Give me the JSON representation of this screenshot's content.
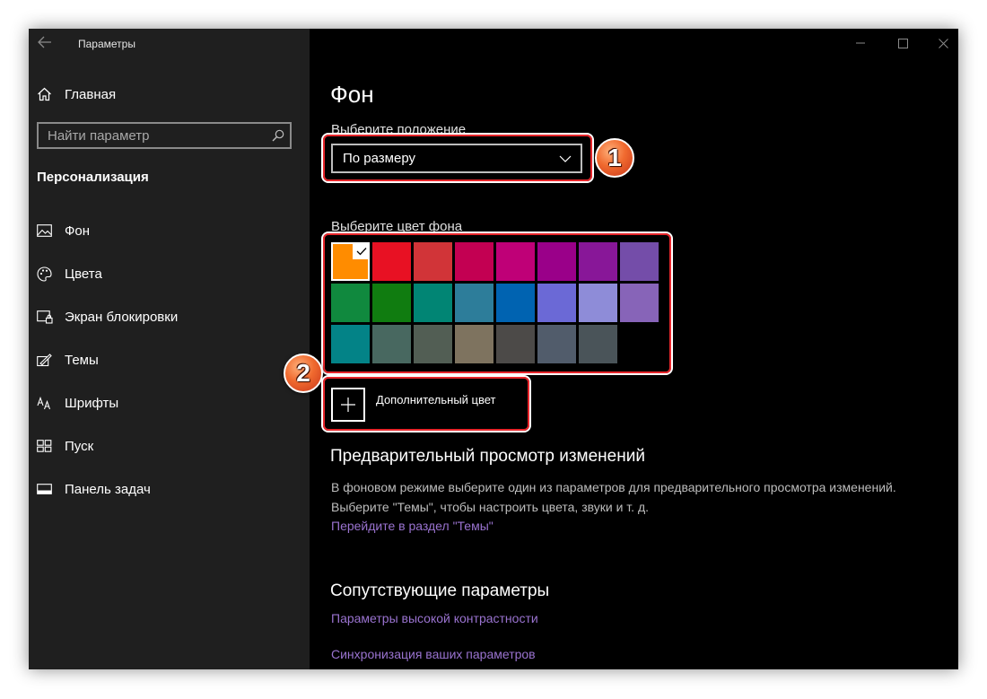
{
  "window": {
    "title": "Параметры"
  },
  "sidebar": {
    "home_label": "Главная",
    "search_placeholder": "Найти параметр",
    "section_title": "Персонализация",
    "items": [
      {
        "label": "Фон",
        "icon": "picture-icon"
      },
      {
        "label": "Цвета",
        "icon": "palette-icon"
      },
      {
        "label": "Экран блокировки",
        "icon": "lock-screen-icon"
      },
      {
        "label": "Темы",
        "icon": "themes-icon"
      },
      {
        "label": "Шрифты",
        "icon": "fonts-icon"
      },
      {
        "label": "Пуск",
        "icon": "start-icon"
      },
      {
        "label": "Панель задач",
        "icon": "taskbar-icon"
      }
    ]
  },
  "main": {
    "title": "Фон",
    "position_label": "Выберите положение",
    "position_value": "По размеру",
    "color_label": "Выберите цвет фона",
    "colors": [
      "#ff8c00",
      "#e81123",
      "#d13438",
      "#c30052",
      "#bf0077",
      "#9a0089",
      "#881798",
      "#744da9",
      "#10893e",
      "#107c10",
      "#018574",
      "#2d7d9a",
      "#0063b1",
      "#6b69d6",
      "#8e8cd8",
      "#8764b8",
      "#038387",
      "#486860",
      "#525e54",
      "#7e735f",
      "#4c4a48",
      "#515c6b",
      "#4a5459",
      "#000000"
    ],
    "selected_color_index": 0,
    "custom_color_label": "Дополнительный цвет",
    "preview_heading": "Предварительный просмотр изменений",
    "preview_desc_line1": "В фоновом режиме выберите один из параметров для предварительного просмотра изменений.",
    "preview_desc_line2": "Выберите \"Темы\", чтобы настроить цвета, звуки и т. д.",
    "themes_link": "Перейдите в раздел \"Темы\"",
    "related_heading": "Сопутствующие параметры",
    "related_links": [
      "Параметры высокой контрастности",
      "Синхронизация ваших параметров"
    ]
  },
  "annotations": {
    "badge_1": "1",
    "badge_2": "2",
    "highlight_color": "#e8262b",
    "badge_color": "#f06a2f"
  },
  "theme": {
    "sidebar_bg": "#1f1f1f",
    "main_bg": "#000000",
    "link_color": "#9a73d0"
  }
}
